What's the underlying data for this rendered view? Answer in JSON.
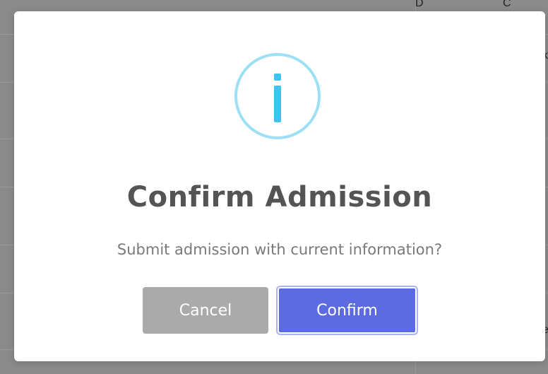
{
  "background": {
    "peek_top_left": "D",
    "peek_top_right": "C",
    "peek_row2": "k",
    "peek_row6": "e"
  },
  "modal": {
    "icon": "info-icon",
    "title": "Confirm Admission",
    "message": "Submit admission with current information?",
    "cancel_label": "Cancel",
    "confirm_label": "Confirm"
  },
  "colors": {
    "icon_ring": "#9de0f6",
    "icon_glyph": "#3fc3ee",
    "confirm": "#5c6be0",
    "cancel": "#aaaaaa",
    "title": "#545454",
    "message": "#797979"
  }
}
